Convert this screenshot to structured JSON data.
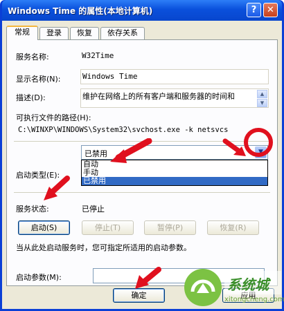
{
  "window": {
    "title": "Windows Time 的属性(本地计算机)",
    "help_glyph": "?",
    "close_glyph": "✕"
  },
  "tabs": [
    {
      "label": "常规",
      "active": true
    },
    {
      "label": "登录",
      "active": false
    },
    {
      "label": "恢复",
      "active": false
    },
    {
      "label": "依存关系",
      "active": false
    }
  ],
  "general": {
    "service_name_label": "服务名称:",
    "service_name_value": "W32Time",
    "display_name_label": "显示名称(N):",
    "display_name_value": "Windows Time",
    "description_label": "描述(D):",
    "description_value": "维护在网络上的所有客户端和服务器的时间和",
    "exe_path_label": "可执行文件的路径(H):",
    "exe_path_value": "C:\\WINXP\\WINDOWS\\System32\\svchost.exe -k netsvcs",
    "startup_type_label": "启动类型(E):",
    "startup_type_value": "已禁用",
    "startup_options": [
      "自动",
      "手动",
      "已禁用"
    ],
    "selected_option": "已禁用",
    "combo_arrow_glyph": "▼",
    "service_status_label": "服务状态:",
    "service_status_value": "已停止",
    "buttons": {
      "start": "启动(S)",
      "stop": "停止(T)",
      "pause": "暂停(P)",
      "resume": "恢复(R)"
    },
    "hint_text": "当从此处启动服务时，您可指定所适用的启动参数。",
    "start_params_label": "启动参数(M):",
    "start_params_value": ""
  },
  "footer": {
    "ok": "确定",
    "apply_partial": "应用"
  },
  "watermark": {
    "brand_text": "系统城",
    "url_text": "xitongcheng.com"
  },
  "colors": {
    "title_bar": "#0a50dc",
    "annotation_red": "#e0101e",
    "selection_blue": "#316ac5",
    "watermark_green": "#7cc243"
  }
}
